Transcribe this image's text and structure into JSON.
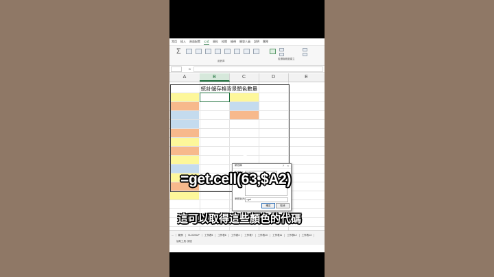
{
  "menu": {
    "tabs": [
      "常用",
      "插入",
      "頁面配置",
      "公式",
      "資料",
      "校閱",
      "檢視",
      "開發人員",
      "說明",
      "團隊"
    ],
    "active_index": 3
  },
  "ribbon": {
    "group_label": "函數庫",
    "right_label": "從選取範圍建立"
  },
  "formula_bar": {
    "fx": "fx"
  },
  "columns": [
    "A",
    "B",
    "C",
    "D",
    "E"
  ],
  "selected_column": "B",
  "sheet_title": "統計儲存格背景顏色數量",
  "colors": {
    "yellow": "#fdf79a",
    "orange": "#f7b98c",
    "blue": "#c4dbee",
    "accent": "#1d6f3b"
  },
  "rows": [
    {
      "a": "yellow",
      "c": "yellow"
    },
    {
      "a": "orange",
      "c": "blue"
    },
    {
      "a": "blue",
      "c": "orange"
    },
    {
      "a": "blue",
      "c": ""
    },
    {
      "a": "orange",
      "c": ""
    },
    {
      "a": "yellow",
      "c": ""
    },
    {
      "a": "orange",
      "c": ""
    },
    {
      "a": "yellow",
      "c": ""
    },
    {
      "a": "blue",
      "c": ""
    },
    {
      "a": "yellow",
      "c": ""
    },
    {
      "a": "orange",
      "c": ""
    },
    {
      "a": "yellow",
      "c": ""
    }
  ],
  "dialog": {
    "title": "新名稱",
    "help": "?",
    "close": "×",
    "name_label": "名稱(N):",
    "name_value": "color",
    "scope_label": "範圍(S):",
    "scope_value": "活頁簿",
    "comment_label": "註解(O):",
    "refers_label": "參照到(R):",
    "refers_value": "=get",
    "ok": "確定",
    "cancel": "取消"
  },
  "sheet_tabs": [
    "...",
    "範例",
    "VLOOKUP",
    "工作表5",
    "工作表6",
    "工作表4",
    "工作表7",
    "工作表10",
    "工作表11",
    "工作表12",
    "工作表13"
  ],
  "status": "協助工具: 調查",
  "captions": {
    "formula": "=get.cell(63,$A2)",
    "subtitle": "這可以取得這些顏色的代碼"
  }
}
